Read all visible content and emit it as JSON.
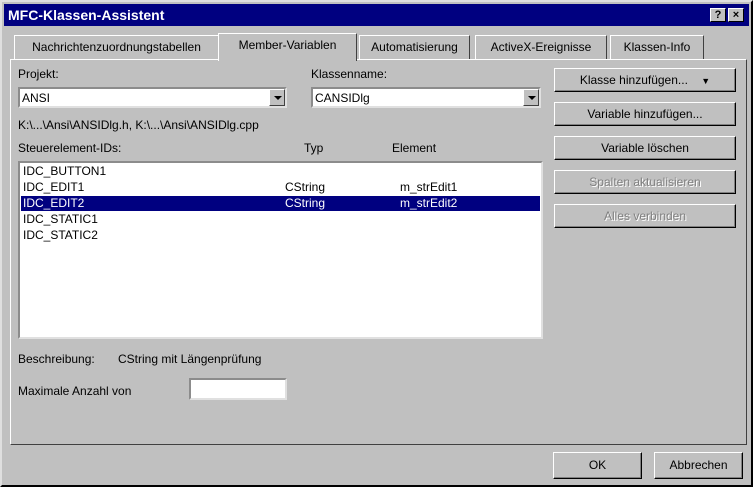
{
  "window": {
    "title": "MFC-Klassen-Assistent",
    "help_btn": "?",
    "close_btn": "×"
  },
  "tabs": [
    {
      "label": "Nachrichtenzuordnungstabellen"
    },
    {
      "label": "Member-Variablen",
      "active": true
    },
    {
      "label": "Automatisierung"
    },
    {
      "label": "ActiveX-Ereignisse"
    },
    {
      "label": "Klassen-Info"
    }
  ],
  "project": {
    "label": "Projekt:",
    "value": "ANSI"
  },
  "classname": {
    "label": "Klassenname:",
    "value": "CANSIDlg"
  },
  "files": "K:\\...\\Ansi\\ANSIDlg.h, K:\\...\\Ansi\\ANSIDlg.cpp",
  "columns": {
    "ids": "Steuerelement-IDs:",
    "type": "Typ",
    "element": "Element"
  },
  "rows": [
    {
      "id": "IDC_BUTTON1",
      "type": "",
      "element": ""
    },
    {
      "id": "IDC_EDIT1",
      "type": "CString",
      "element": "m_strEdit1"
    },
    {
      "id": "IDC_EDIT2",
      "type": "CString",
      "element": "m_strEdit2",
      "selected": true
    },
    {
      "id": "IDC_STATIC1",
      "type": "",
      "element": ""
    },
    {
      "id": "IDC_STATIC2",
      "type": "",
      "element": ""
    }
  ],
  "buttons": {
    "add_class": "Klasse hinzufügen...",
    "add_variable": "Variable hinzufügen...",
    "delete_variable": "Variable löschen",
    "update_columns": "Spalten aktualisieren",
    "bind_all": "Alles verbinden",
    "ok": "OK",
    "cancel": "Abbrechen"
  },
  "description": {
    "label": "Beschreibung:",
    "value": "CString mit Längenprüfung"
  },
  "maxlen": {
    "label": "Maximale Anzahl von",
    "value": ""
  },
  "colors": {
    "titlebar": "#000080",
    "face": "#c0c0c0",
    "selection": "#000080"
  }
}
